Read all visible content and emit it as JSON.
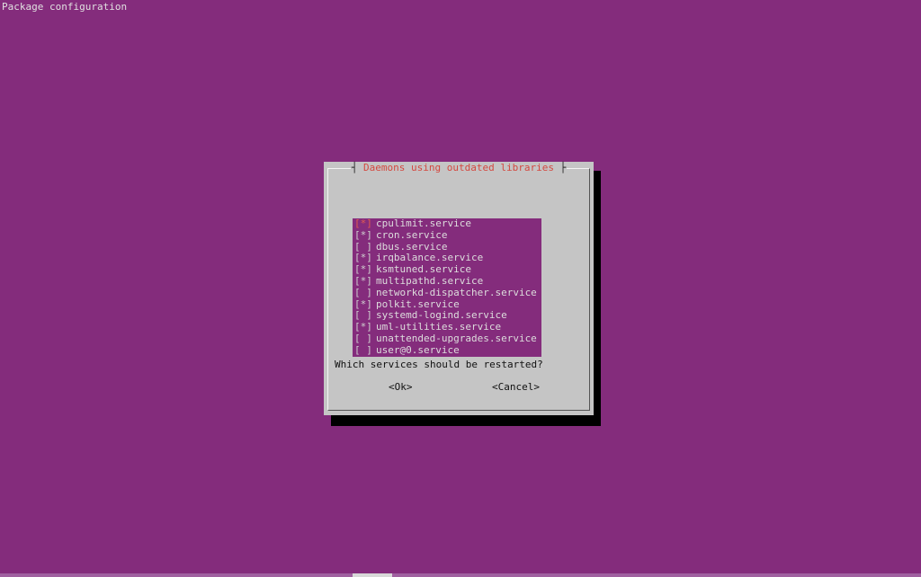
{
  "screen": {
    "header_title": "Package configuration"
  },
  "dialog": {
    "title": "Daemons using outdated libraries",
    "question": "Which services should be restarted?",
    "services": [
      {
        "checkbox": "[*]",
        "label": "cpulimit.service",
        "focused": true
      },
      {
        "checkbox": "[*]",
        "label": "cron.service",
        "focused": false
      },
      {
        "checkbox": "[ ]",
        "label": "dbus.service",
        "focused": false
      },
      {
        "checkbox": "[*]",
        "label": "irqbalance.service",
        "focused": false
      },
      {
        "checkbox": "[*]",
        "label": "ksmtuned.service",
        "focused": false
      },
      {
        "checkbox": "[*]",
        "label": "multipathd.service",
        "focused": false
      },
      {
        "checkbox": "[ ]",
        "label": "networkd-dispatcher.service",
        "focused": false
      },
      {
        "checkbox": "[*]",
        "label": "polkit.service",
        "focused": false
      },
      {
        "checkbox": "[ ]",
        "label": "systemd-logind.service",
        "focused": false
      },
      {
        "checkbox": "[*]",
        "label": "uml-utilities.service",
        "focused": false
      },
      {
        "checkbox": "[ ]",
        "label": "unattended-upgrades.service",
        "focused": false
      },
      {
        "checkbox": "[ ]",
        "label": "user@0.service",
        "focused": false
      }
    ],
    "ok_label": "<Ok>",
    "cancel_label": "<Cancel>"
  },
  "colors": {
    "background": "#842c7c",
    "dialog": "#c5c5c5",
    "title_text": "#d4483f",
    "shadow": "#000000"
  }
}
